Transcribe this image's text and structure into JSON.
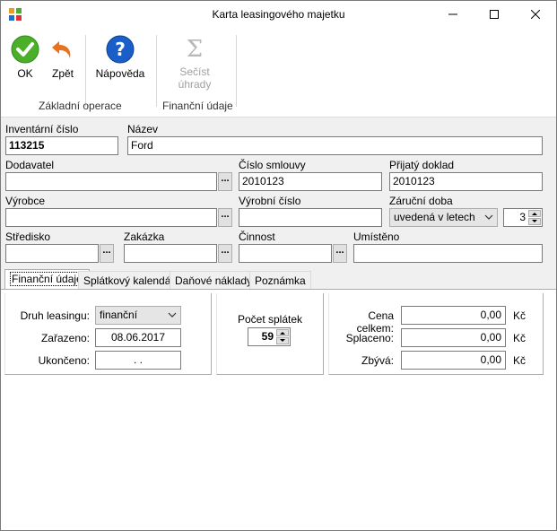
{
  "window": {
    "title": "Karta leasingového majetku"
  },
  "ribbon": {
    "ok_label": "OK",
    "back_label": "Zpět",
    "help_label": "Nápověda",
    "sum_label_1": "Sečíst",
    "sum_label_2": "úhrady",
    "group_basic": "Základní operace",
    "group_finance": "Finanční údaje"
  },
  "form": {
    "inv_label": "Inventární číslo",
    "inv_value": "113215",
    "name_label": "Název",
    "name_value": "Ford",
    "supplier_label": "Dodavatel",
    "supplier_value": "",
    "contract_label": "Číslo smlouvy",
    "contract_value": "2010123",
    "received_label": "Přijatý doklad",
    "received_value": "2010123",
    "maker_label": "Výrobce",
    "maker_value": "",
    "serial_label": "Výrobní číslo",
    "serial_value": "",
    "warranty_label": "Záruční doba",
    "warranty_unit": "uvedená v letech",
    "warranty_value": "3",
    "center_label": "Středisko",
    "center_value": "",
    "order_label": "Zakázka",
    "order_value": "",
    "activity_label": "Činnost",
    "activity_value": "",
    "location_label": "Umístěno",
    "location_value": ""
  },
  "tabs": [
    {
      "label": "Finanční údaje"
    },
    {
      "label": "Splátkový kalendář"
    },
    {
      "label": "Daňové náklady"
    },
    {
      "label": "Poznámka"
    }
  ],
  "finance": {
    "type_label": "Druh leasingu:",
    "type_value": "finanční",
    "assigned_label": "Zařazeno:",
    "assigned_value": "08.06.2017",
    "ended_label": "Ukončeno:",
    "ended_value": ". .",
    "installments_label": "Počet splátek",
    "installments_value": "59",
    "total_label": "Cena celkem:",
    "total_value": "0,00",
    "paid_label": "Splaceno:",
    "paid_value": "0,00",
    "remaining_label": "Zbývá:",
    "remaining_value": "0,00",
    "currency": "Kč"
  },
  "icons": {
    "app": "app-icon",
    "ok": "check-icon",
    "back": "undo-arrow-icon",
    "help": "question-icon",
    "sum": "sigma-icon"
  },
  "colors": {
    "ok_green": "#4caf2a",
    "back_orange": "#e8731e",
    "help_blue": "#1a5fc8"
  }
}
